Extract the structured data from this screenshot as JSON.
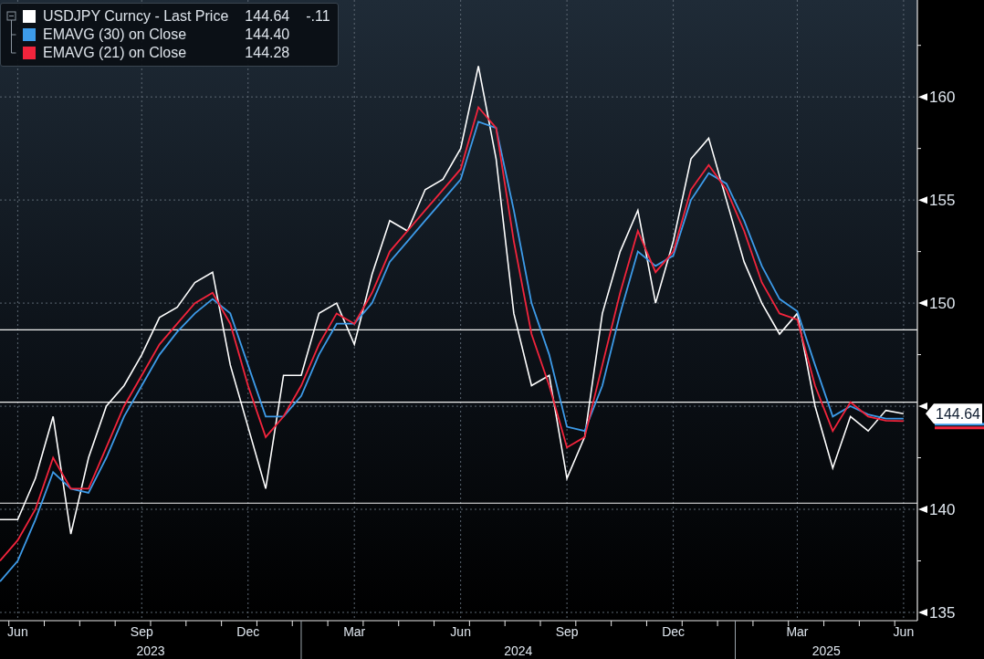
{
  "legend": {
    "items": [
      {
        "value": "144.64",
        "change": "-.11"
      },
      {
        "value": "144.40"
      },
      {
        "value": "144.28"
      }
    ]
  },
  "chart": {
    "last_price_tag": "144.64",
    "year_labels": [
      "2023",
      "2024",
      "2025"
    ],
    "chart_data": {
      "type": "line",
      "categories": [
        null,
        "Jun",
        null,
        null,
        null,
        null,
        null,
        null,
        "Sep",
        null,
        null,
        null,
        null,
        null,
        "Dec",
        null,
        null,
        null,
        null,
        null,
        "Mar",
        null,
        null,
        null,
        null,
        null,
        "Jun",
        null,
        null,
        null,
        null,
        null,
        "Sep",
        null,
        null,
        null,
        null,
        null,
        "Dec",
        null,
        null,
        null,
        null,
        null,
        null,
        "Mar",
        null,
        null,
        null,
        null,
        null,
        "Jun"
      ],
      "series": [
        {
          "name": "USDJPY Curncy - Last Price",
          "color": "#ffffff",
          "values": [
            139.5,
            139.5,
            141.5,
            144.5,
            138.8,
            142.5,
            145,
            146,
            147.5,
            149.3,
            149.8,
            151,
            151.5,
            147,
            144,
            141,
            146.5,
            146.5,
            149.5,
            150,
            148,
            151.4,
            154,
            153.5,
            155.5,
            156,
            157.5,
            161.5,
            157,
            149.5,
            146,
            146.5,
            141.5,
            143.5,
            149.5,
            152.5,
            154.5,
            150,
            153,
            157,
            158,
            155,
            152,
            150,
            148.5,
            149.5,
            145,
            142,
            144.5,
            143.8,
            144.8,
            144.64
          ]
        },
        {
          "name": "EMAVG (30) on Close",
          "color": "#3d9be9",
          "values": [
            136.5,
            137.5,
            139.5,
            141.8,
            141,
            140.8,
            142.5,
            144.5,
            146,
            147.5,
            148.6,
            149.5,
            150.2,
            149.5,
            147,
            144.5,
            144.5,
            145.5,
            147.5,
            149,
            149,
            150,
            152,
            153,
            154,
            155,
            156,
            158.8,
            158.5,
            154.5,
            150,
            147.5,
            144,
            143.8,
            146,
            149.5,
            152.5,
            151.8,
            152.3,
            155,
            156.3,
            155.8,
            154,
            151.8,
            150.2,
            149.6,
            147,
            144.5,
            145,
            144.6,
            144.4,
            144.4
          ]
        },
        {
          "name": "EMAVG (21) on Close",
          "color": "#f2243c",
          "values": [
            137.5,
            138.5,
            140,
            142.5,
            141,
            141,
            143,
            145,
            146.5,
            148,
            149,
            150,
            150.5,
            149,
            146,
            143.5,
            144.5,
            146,
            148,
            149.5,
            149,
            150.5,
            152.5,
            153.5,
            154.5,
            155.5,
            156.5,
            159.5,
            158.5,
            153,
            148.5,
            146,
            143,
            143.5,
            147,
            150.5,
            153.5,
            151.5,
            152.5,
            155.5,
            156.7,
            155.5,
            153.5,
            151,
            149.5,
            149.2,
            146,
            143.8,
            145.2,
            144.5,
            144.3,
            144.28
          ]
        }
      ],
      "yticks": [
        135,
        140,
        150,
        155,
        160
      ],
      "ylim": [
        134.6,
        164.7
      ],
      "grid": true,
      "legend": true,
      "ref_lines": [
        {
          "axis": "y",
          "value": 148.7
        },
        {
          "axis": "y",
          "value": 145.2
        },
        {
          "axis": "y",
          "value": 140.3
        }
      ]
    }
  }
}
